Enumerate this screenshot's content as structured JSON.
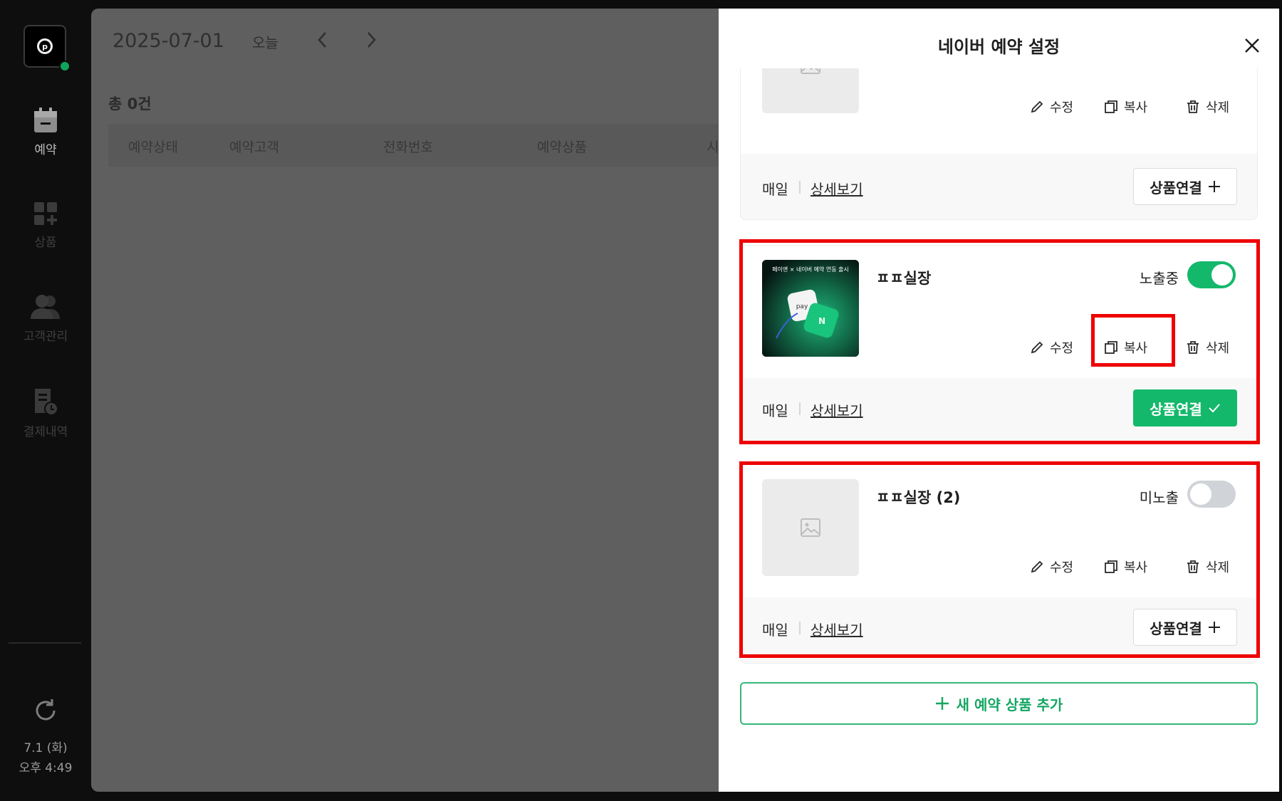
{
  "sidebar": {
    "items": [
      {
        "label": "예약",
        "icon": "calendar-icon"
      },
      {
        "label": "상품",
        "icon": "product-grid-icon"
      },
      {
        "label": "고객관리",
        "icon": "customers-icon"
      },
      {
        "label": "결제내역",
        "icon": "payment-history-icon"
      }
    ],
    "date": "7.1 (화)",
    "time": "오후 4:49"
  },
  "main": {
    "date": "2025-07-01",
    "today_label": "오늘",
    "total": "총 0건",
    "columns": [
      "예약상태",
      "예약고객",
      "전화번호",
      "예약상품",
      "시"
    ]
  },
  "panel": {
    "title": "네이버 예약 설정",
    "actions": {
      "edit": "수정",
      "copy": "복사",
      "delete": "삭제"
    },
    "frequency": "매일",
    "detail_label": "상세보기",
    "link_label": "상품연결",
    "products": [
      {
        "name": "",
        "visibility": "",
        "linked": false
      },
      {
        "name": "ㅍㅍ실장",
        "visibility": "노출중",
        "linked": true,
        "thumb_text": "페이앤 × 네이버 예약 연동 출시"
      },
      {
        "name": "ㅍㅍ실장 (2)",
        "visibility": "미노출",
        "linked": false
      }
    ],
    "add_label": "새 예약 상품 추가"
  },
  "colors": {
    "accent": "#14b86b",
    "highlight": "#ee0000"
  }
}
